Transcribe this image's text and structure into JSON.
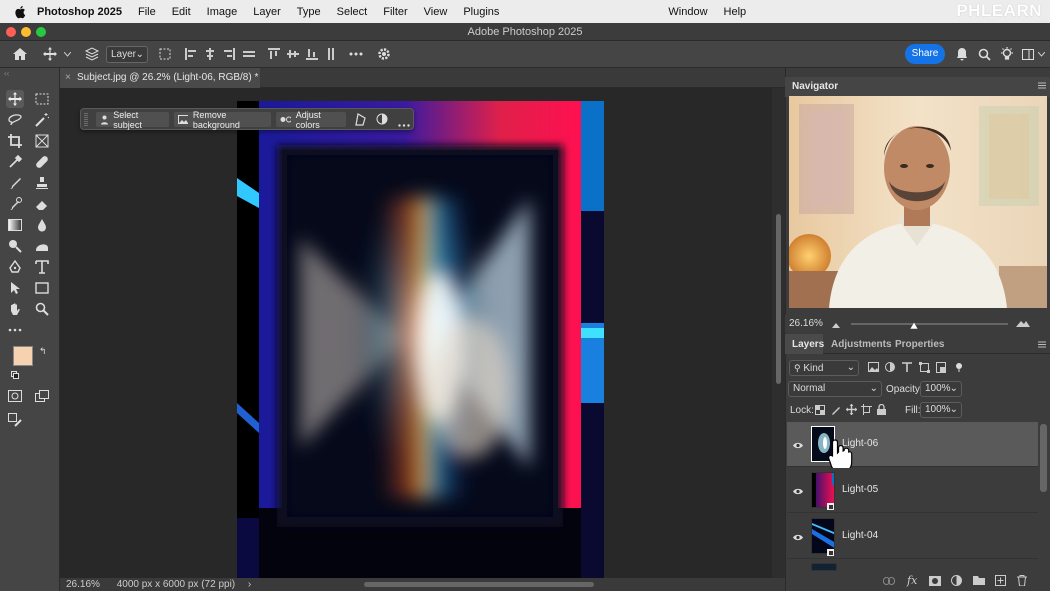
{
  "menubar": {
    "app_name": "Photoshop 2025",
    "items": [
      "File",
      "Edit",
      "Image",
      "Layer",
      "Type",
      "Select",
      "Filter",
      "View",
      "Plugins",
      "Window",
      "Help"
    ],
    "watermark": "PHLEARN"
  },
  "window": {
    "title": "Adobe Photoshop 2025"
  },
  "options_bar": {
    "layer_select": "Layer",
    "share_label": "Share"
  },
  "document_tab": {
    "label": "Subject.jpg @ 26.2% (Light-06, RGB/8) *",
    "close": "×"
  },
  "context_bar": {
    "select_subject": "Select subject",
    "remove_background": "Remove background",
    "adjust_colors": "Adjust colors"
  },
  "status_bar": {
    "zoom": "26.16%",
    "doc_info": "4000 px x 6000 px (72 ppi)",
    "arrow": "›"
  },
  "colors": {
    "foreground": "#f6d2b0",
    "background": "#000000",
    "accent": "#1473e6"
  },
  "navigator": {
    "title": "Navigator",
    "zoom": "26.16%"
  },
  "panel_tabs": {
    "layers": "Layers",
    "adjustments": "Adjustments",
    "properties": "Properties"
  },
  "layers_panel": {
    "filter": "Kind",
    "blend_mode": "Normal",
    "opacity_label": "Opacity:",
    "opacity_value": "100%",
    "lock_label": "Lock:",
    "fill_label": "Fill:",
    "fill_value": "100%",
    "layers": [
      {
        "name": "Light-06",
        "selected": true
      },
      {
        "name": "Light-05",
        "selected": false
      },
      {
        "name": "Light-04",
        "selected": false
      }
    ]
  }
}
